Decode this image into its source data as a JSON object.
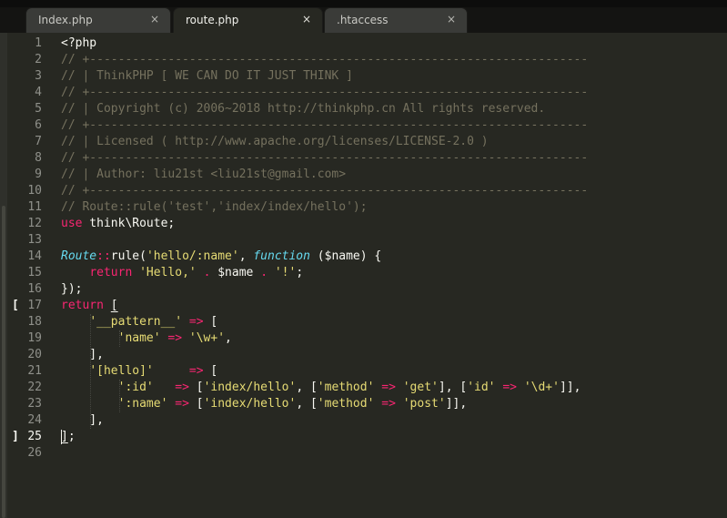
{
  "tabs": [
    {
      "label": "Index.php",
      "close": "×",
      "active": false
    },
    {
      "label": "route.php",
      "close": "×",
      "active": true
    },
    {
      "label": ".htaccess",
      "close": "×",
      "active": false
    }
  ],
  "editor": {
    "current_line": 25,
    "line_numbers": [
      "1",
      "2",
      "3",
      "4",
      "5",
      "6",
      "7",
      "8",
      "9",
      "10",
      "11",
      "12",
      "13",
      "14",
      "15",
      "16",
      "17",
      "18",
      "19",
      "20",
      "21",
      "22",
      "23",
      "24",
      "25",
      "26"
    ],
    "fold_marks": [
      {
        "line": 17,
        "glyph": "["
      },
      {
        "line": 25,
        "glyph": "]"
      }
    ],
    "lines": [
      [
        [
          "t-plain",
          "<?php"
        ]
      ],
      [
        [
          "t-comment",
          "// +----------------------------------------------------------------------"
        ]
      ],
      [
        [
          "t-comment",
          "// | ThinkPHP [ WE CAN DO IT JUST THINK ]"
        ]
      ],
      [
        [
          "t-comment",
          "// +----------------------------------------------------------------------"
        ]
      ],
      [
        [
          "t-comment",
          "// | Copyright (c) 2006~2018 http://thinkphp.cn All rights reserved."
        ]
      ],
      [
        [
          "t-comment",
          "// +----------------------------------------------------------------------"
        ]
      ],
      [
        [
          "t-comment",
          "// | Licensed ( http://www.apache.org/licenses/LICENSE-2.0 )"
        ]
      ],
      [
        [
          "t-comment",
          "// +----------------------------------------------------------------------"
        ]
      ],
      [
        [
          "t-comment",
          "// | Author: liu21st <liu21st@gmail.com>"
        ]
      ],
      [
        [
          "t-comment",
          "// +----------------------------------------------------------------------"
        ]
      ],
      [
        [
          "t-comment",
          "// Route::rule('test','index/index/hello');"
        ]
      ],
      [
        [
          "t-keyword",
          "use"
        ],
        [
          "t-plain",
          " think\\Route;"
        ]
      ],
      [],
      [
        [
          "t-class",
          "Route"
        ],
        [
          "t-op",
          "::"
        ],
        [
          "t-plain",
          "rule("
        ],
        [
          "t-string",
          "'hello/:name'"
        ],
        [
          "t-plain",
          ", "
        ],
        [
          "t-storage",
          "function"
        ],
        [
          "t-plain",
          " ("
        ],
        [
          "t-var",
          "$name"
        ],
        [
          "t-plain",
          ") {"
        ]
      ],
      [
        [
          "t-plain",
          "    "
        ],
        [
          "t-keyword",
          "return"
        ],
        [
          "t-plain",
          " "
        ],
        [
          "t-string",
          "'Hello,'"
        ],
        [
          "t-plain",
          " "
        ],
        [
          "t-op",
          "."
        ],
        [
          "t-plain",
          " $name "
        ],
        [
          "t-op",
          "."
        ],
        [
          "t-plain",
          " "
        ],
        [
          "t-string",
          "'!'"
        ],
        [
          "t-plain",
          ";"
        ]
      ],
      [
        [
          "t-plain",
          "});"
        ]
      ],
      [
        [
          "t-keyword",
          "return"
        ],
        [
          "t-plain",
          " "
        ],
        [
          "t-bracket",
          "["
        ]
      ],
      [
        [
          "t-plain",
          "    "
        ],
        [
          "t-string",
          "'__pattern__'"
        ],
        [
          "t-plain",
          " "
        ],
        [
          "t-op",
          "=>"
        ],
        [
          "t-plain",
          " ["
        ]
      ],
      [
        [
          "t-plain",
          "        "
        ],
        [
          "t-string",
          "'name'"
        ],
        [
          "t-plain",
          " "
        ],
        [
          "t-op",
          "=>"
        ],
        [
          "t-plain",
          " "
        ],
        [
          "t-string",
          "'\\w+'"
        ],
        [
          "t-plain",
          ","
        ]
      ],
      [
        [
          "t-plain",
          "    ],"
        ]
      ],
      [
        [
          "t-plain",
          "    "
        ],
        [
          "t-string",
          "'[hello]'"
        ],
        [
          "t-plain",
          "     "
        ],
        [
          "t-op",
          "=>"
        ],
        [
          "t-plain",
          " ["
        ]
      ],
      [
        [
          "t-plain",
          "        "
        ],
        [
          "t-string",
          "':id'"
        ],
        [
          "t-plain",
          "   "
        ],
        [
          "t-op",
          "=>"
        ],
        [
          "t-plain",
          " ["
        ],
        [
          "t-string",
          "'index/hello'"
        ],
        [
          "t-plain",
          ", ["
        ],
        [
          "t-string",
          "'method'"
        ],
        [
          "t-plain",
          " "
        ],
        [
          "t-op",
          "=>"
        ],
        [
          "t-plain",
          " "
        ],
        [
          "t-string",
          "'get'"
        ],
        [
          "t-plain",
          "], ["
        ],
        [
          "t-string",
          "'id'"
        ],
        [
          "t-plain",
          " "
        ],
        [
          "t-op",
          "=>"
        ],
        [
          "t-plain",
          " "
        ],
        [
          "t-string",
          "'\\d+'"
        ],
        [
          "t-plain",
          "]],"
        ]
      ],
      [
        [
          "t-plain",
          "        "
        ],
        [
          "t-string",
          "':name'"
        ],
        [
          "t-plain",
          " "
        ],
        [
          "t-op",
          "=>"
        ],
        [
          "t-plain",
          " ["
        ],
        [
          "t-string",
          "'index/hello'"
        ],
        [
          "t-plain",
          ", ["
        ],
        [
          "t-string",
          "'method'"
        ],
        [
          "t-plain",
          " "
        ],
        [
          "t-op",
          "=>"
        ],
        [
          "t-plain",
          " "
        ],
        [
          "t-string",
          "'post'"
        ],
        [
          "t-plain",
          "]],"
        ]
      ],
      [
        [
          "t-plain",
          "    ],"
        ]
      ],
      [
        [
          "t-bracket",
          "]"
        ],
        [
          "t-plain",
          ";"
        ]
      ],
      []
    ]
  },
  "colors": {
    "background": "#272822",
    "comment": "#75715e",
    "string": "#e6db74",
    "keyword": "#f92672",
    "storage": "#66d9ef",
    "foreground": "#f8f8f2"
  }
}
